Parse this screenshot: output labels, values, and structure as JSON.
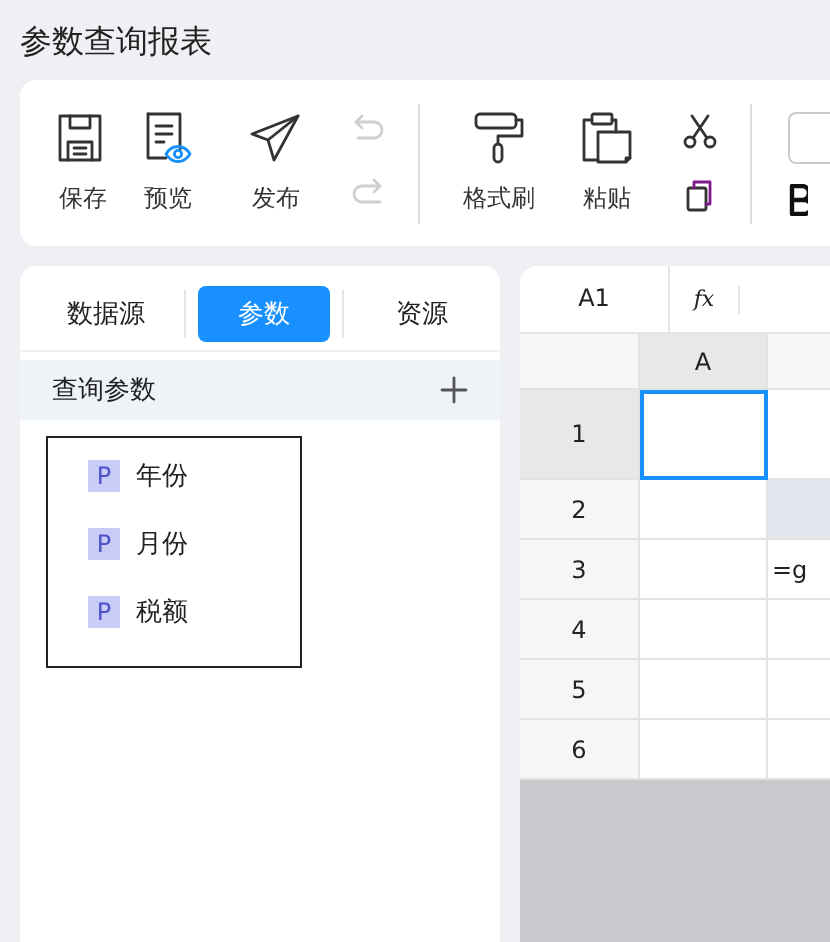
{
  "title": "参数查询报表",
  "toolbar": {
    "items": [
      {
        "kind": "big",
        "label": "保存"
      },
      {
        "kind": "big",
        "label": "预览"
      },
      {
        "kind": "big",
        "label": "发布"
      },
      {
        "kind": "stack",
        "disabled": true
      },
      {
        "kind": "divider"
      },
      {
        "kind": "big",
        "label": "格式刷"
      },
      {
        "kind": "big",
        "label": "粘贴"
      },
      {
        "kind": "stack",
        "disabled": false
      },
      {
        "kind": "divider"
      },
      {
        "kind": "font"
      }
    ]
  },
  "panel": {
    "tabs": [
      {
        "label": "数据源",
        "selected": false
      },
      {
        "label": "参数",
        "selected": true
      },
      {
        "label": "资源",
        "selected": false
      }
    ],
    "section": {
      "title": "查询参数"
    },
    "params": [
      {
        "badge": "P",
        "name": "年份"
      },
      {
        "badge": "P",
        "name": "月份"
      },
      {
        "badge": "P",
        "name": "税额"
      }
    ]
  },
  "sheet": {
    "name_box": "A1",
    "formula_label": "fx",
    "columns": [
      "A"
    ],
    "rows": [
      {
        "label": "1",
        "selected": true,
        "column_2_shaded": false
      },
      {
        "label": "2",
        "selected": false,
        "column_2_shaded": true
      },
      {
        "label": "3",
        "selected": false,
        "column_2_shaded": false,
        "column_2": "=g"
      },
      {
        "label": "4",
        "selected": false,
        "column_2_shaded": false
      },
      {
        "label": "5",
        "selected": false,
        "column_2_shaded": false
      },
      {
        "label": "6",
        "selected": false,
        "column_2_shaded": false
      }
    ]
  }
}
